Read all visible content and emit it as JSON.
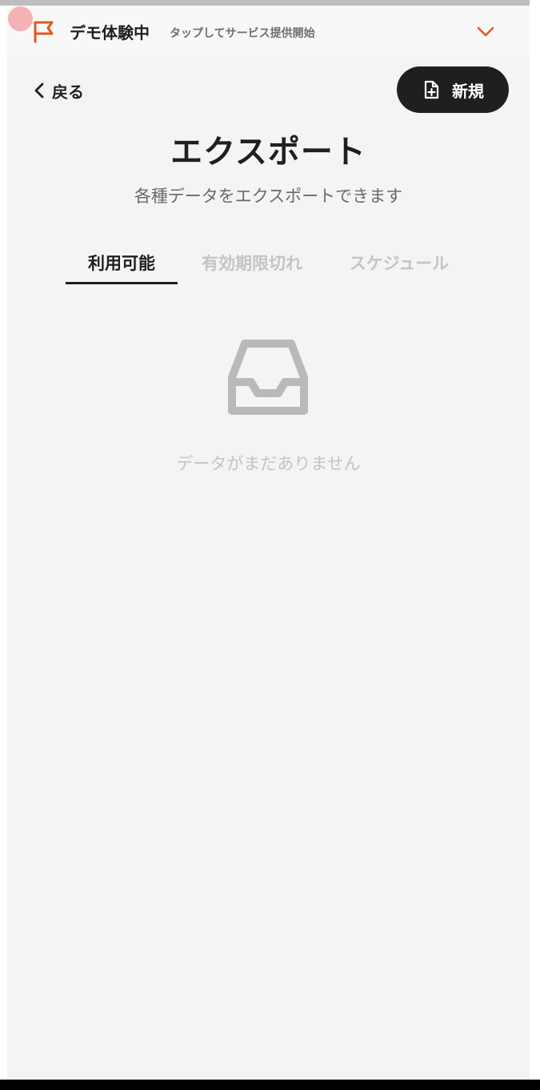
{
  "banner": {
    "title": "デモ体験中",
    "subtitle": "タップしてサービス提供開始",
    "flag_icon": "flag-icon",
    "chevron_icon": "chevron-down-icon",
    "accent_color": "#e2571e"
  },
  "header": {
    "back_label": "戻る",
    "back_icon": "chevron-left-icon",
    "new_label": "新規",
    "new_icon": "file-plus-icon"
  },
  "page": {
    "title": "エクスポート",
    "subtitle": "各種データをエクスポートできます"
  },
  "tabs": [
    {
      "label": "利用可能",
      "active": true
    },
    {
      "label": "有効期限切れ",
      "active": false
    },
    {
      "label": "スケジュール",
      "active": false
    }
  ],
  "empty_state": {
    "icon": "inbox-icon",
    "message": "データがまだありません"
  },
  "colors": {
    "primary_text": "#1f1f1f",
    "muted_text": "#c4c4c4",
    "background": "#f4f4f4",
    "accent": "#e2571e"
  }
}
